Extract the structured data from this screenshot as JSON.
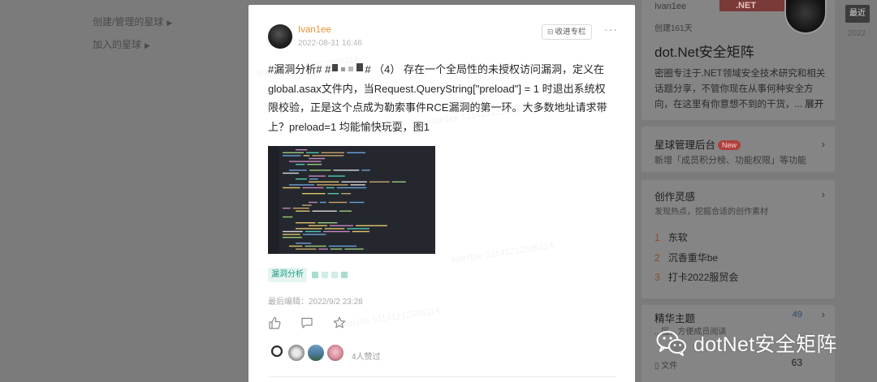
{
  "left_nav": {
    "items": [
      {
        "label": "创建/管理的星球"
      },
      {
        "label": "加入的星球"
      }
    ]
  },
  "planet": {
    "owner_name": "Ivan1ee",
    "banner_text": ".NET",
    "created": "创建161天",
    "title": "dot.Net安全矩阵",
    "description": "密圈专注于.NET领域安全技术研究和相关话题分享，不管你现在从事何种安全方向，在这里有你意想不到的干货，...",
    "expand_label": "展开"
  },
  "admin": {
    "title": "星球管理后台",
    "badge": "New",
    "description": "新增「成员积分榜、功能权限」等功能"
  },
  "inspiration": {
    "title": "创作灵感",
    "description": "发现热点，挖掘合适的创作素材",
    "items": [
      {
        "rank": "1",
        "label": "东软"
      },
      {
        "rank": "2",
        "label": "沉香重华be"
      },
      {
        "rank": "3",
        "label": "打卡2022服贸会"
      }
    ]
  },
  "essence": {
    "title": "精华主题",
    "count": "49",
    "description": "...区，方便成员阅读",
    "files_label": "文件",
    "files_count": "63"
  },
  "timeline": {
    "recent": "最近",
    "year": "2022"
  },
  "post": {
    "author": "Ivan1ee",
    "datetime": "2022-08-31 16:46",
    "collect_label": "收进专栏",
    "more_label": "···",
    "content_prefix": "#漏洞分析# #",
    "content_after_redact": "# （4） 存在一个全局性的未授权访问漏洞，定义在global.asax文件内，当Request.QueryString[\"preload\"] = 1 时退出系统权限校验，正是这个点成为勒索事件RCE漏洞的第一环。大多数地址请求带上？preload=1 均能愉快玩耍，图1",
    "tags": [
      {
        "label": "漏洞分析"
      }
    ],
    "edited": "最后编辑：2022/9/2 23:28",
    "likes_text": "4人赞过",
    "watermark": "Ivan1ee 51141212595114"
  },
  "source_watermark": "dotNet安全矩阵",
  "colors": {
    "author": "#e8913a",
    "tag_text": "#1a9e80",
    "tag_bg": "#e6f5f1",
    "new_badge": "#b0413e"
  },
  "icons": [
    "collect-icon",
    "more-icon",
    "like-icon",
    "comment-icon",
    "star-icon",
    "chevron-right-icon",
    "wechat-icon"
  ]
}
